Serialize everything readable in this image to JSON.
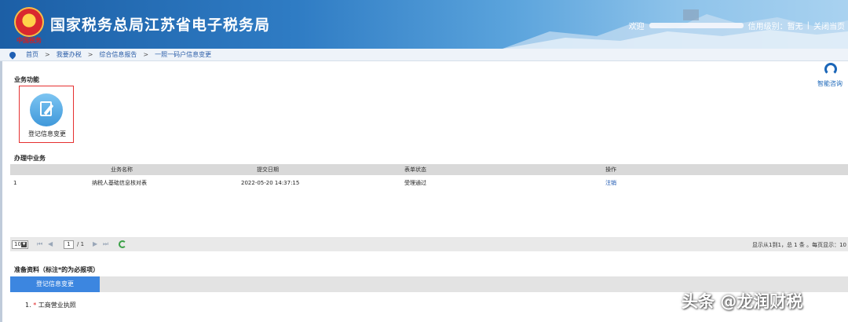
{
  "header": {
    "emblem_caption": "中国税务",
    "title": "国家税务总局江苏省电子税务局",
    "welcome": "欢迎",
    "credit": "信用级别：暂无",
    "separator": "|",
    "close_page": "关闭当页"
  },
  "breadcrumb": {
    "items": [
      "首页",
      "我要办税",
      "综合信息报告",
      "一照一码户信息变更"
    ],
    "arrow": ">"
  },
  "consult": {
    "label": "智能咨询"
  },
  "business": {
    "title": "业务功能",
    "items": [
      {
        "label": "登记信息变更",
        "icon": "edit-document-icon"
      }
    ]
  },
  "in_progress": {
    "title": "办理中业务",
    "columns": [
      "业务名称",
      "提交日期",
      "表单状态",
      "操作"
    ],
    "rows": [
      {
        "index": "1",
        "name": "纳税人基础信息核对表",
        "date": "2022-05-20 14:37:15",
        "status": "受理通过",
        "action": "注销"
      }
    ]
  },
  "pager": {
    "page_size": "10",
    "first": "⏮",
    "prev": "◀",
    "current_page": "1",
    "total_pages": "/ 1",
    "next": "▶",
    "last": "⏭",
    "info": "显示从1到1，总 1 条 。每页显示：10"
  },
  "prep": {
    "title": "准备资料（标注*的为必报项）",
    "tab_label": "登记信息变更",
    "items": [
      {
        "number": "1.",
        "star": "*",
        "text": "工商营业执照"
      }
    ]
  },
  "watermark": "头条 @龙润财税",
  "colors": {
    "header_blue": "#1c5fa6",
    "tab_blue": "#3c86e0",
    "highlight_red": "#e53030",
    "link_blue": "#1a55b0"
  }
}
